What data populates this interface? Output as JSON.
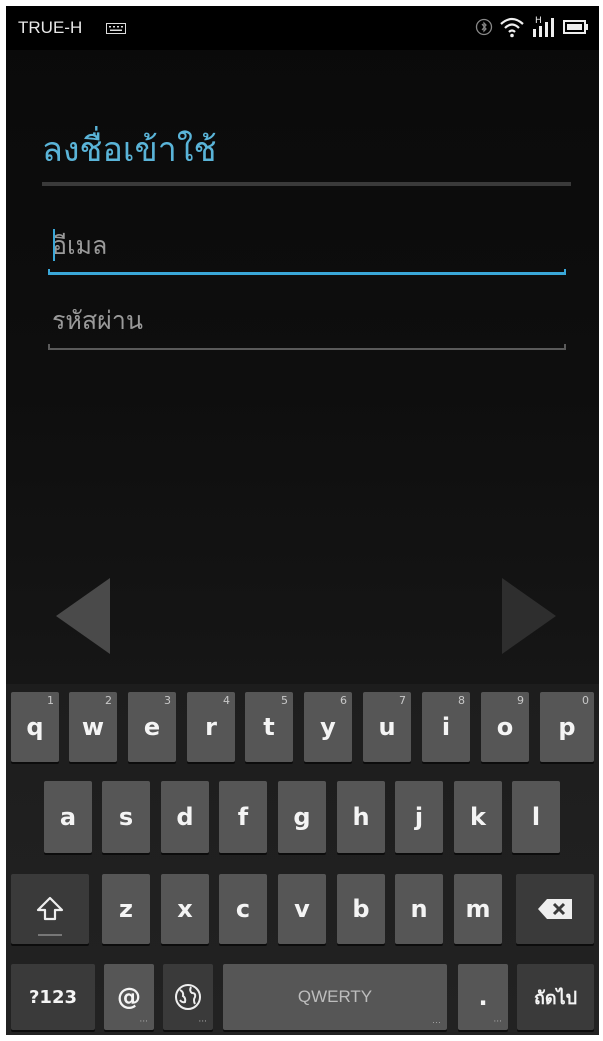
{
  "status_bar": {
    "carrier": "TRUE-H",
    "icons": [
      "keyboard-icon",
      "bluetooth-icon",
      "wifi-icon",
      "signal-icon",
      "battery-icon"
    ],
    "network_type": "H"
  },
  "login": {
    "title": "ลงชื่อเข้าใช้",
    "email_placeholder": "อีเมล",
    "password_placeholder": "รหัสผ่าน",
    "accent_color": "#3aa7d8"
  },
  "nav": {
    "prev_icon": "arrow-left-icon",
    "next_icon": "arrow-right-icon"
  },
  "keyboard": {
    "row1": [
      {
        "label": "q",
        "hint": "1"
      },
      {
        "label": "w",
        "hint": "2"
      },
      {
        "label": "e",
        "hint": "3"
      },
      {
        "label": "r",
        "hint": "4"
      },
      {
        "label": "t",
        "hint": "5"
      },
      {
        "label": "y",
        "hint": "6"
      },
      {
        "label": "u",
        "hint": "7"
      },
      {
        "label": "i",
        "hint": "8"
      },
      {
        "label": "o",
        "hint": "9"
      },
      {
        "label": "p",
        "hint": "0"
      }
    ],
    "row2": [
      "a",
      "s",
      "d",
      "f",
      "g",
      "h",
      "j",
      "k",
      "l"
    ],
    "row3": [
      "z",
      "x",
      "c",
      "v",
      "b",
      "n",
      "m"
    ],
    "symbols_label": "?123",
    "at_label": "@",
    "space_label": "QWERTY",
    "period_label": ".",
    "next_label": "ถัดไป",
    "shift_icon": "shift-icon",
    "delete_icon": "backspace-icon",
    "language_icon": "globe-icon"
  }
}
